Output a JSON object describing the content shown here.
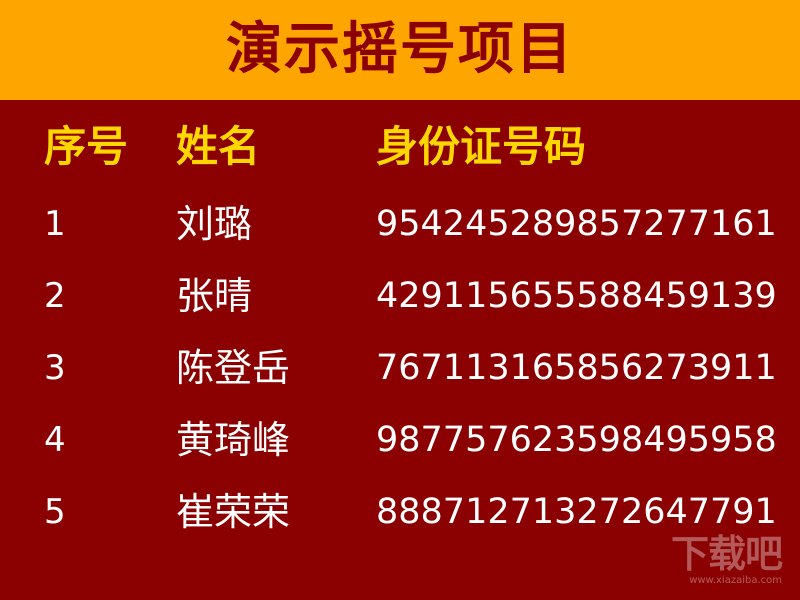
{
  "header": {
    "title": "演示摇号项目",
    "background": "#ffa500",
    "title_color": "#8b0000"
  },
  "table": {
    "background": "#8b0000",
    "header_color": "#ffd700",
    "text_color": "#ffffff",
    "columns": [
      "序号",
      "姓名",
      "身份证号码"
    ],
    "rows": [
      {
        "no": "1",
        "name": "刘璐",
        "id": "954245289857277161"
      },
      {
        "no": "2",
        "name": "张晴",
        "id": "429115655588459139"
      },
      {
        "no": "3",
        "name": "陈登岳",
        "id": "767113165856273911"
      },
      {
        "no": "4",
        "name": "黄琦峰",
        "id": "987757623598495958"
      },
      {
        "no": "5",
        "name": "崔荣荣",
        "id": "888712713272647791"
      }
    ]
  },
  "watermark": {
    "mark": "下载吧",
    "site": "www.xiazaiba.com"
  }
}
